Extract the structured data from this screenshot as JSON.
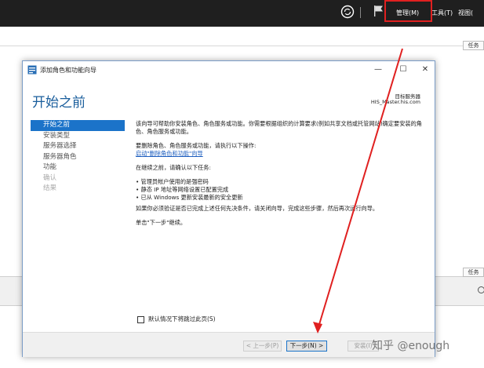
{
  "server_manager": {
    "menu": {
      "manage": "管理(M)",
      "tools": "工具(T)",
      "view": "视图("
    },
    "tasks_label": "任务",
    "highlight_color": "#e02020"
  },
  "wizard": {
    "window_title": "添加角色和功能向导",
    "page_title": "开始之前",
    "target_server_label": "目标服务器",
    "target_server_name": "HIS_Master.his.com",
    "nav": [
      {
        "label": "开始之前",
        "state": "active"
      },
      {
        "label": "安装类型",
        "state": "normal"
      },
      {
        "label": "服务器选择",
        "state": "normal"
      },
      {
        "label": "服务器角色",
        "state": "normal"
      },
      {
        "label": "功能",
        "state": "normal"
      },
      {
        "label": "确认",
        "state": "disabled"
      },
      {
        "label": "结果",
        "state": "disabled"
      }
    ],
    "content": {
      "intro": "该向导可帮助你安装角色、角色服务或功能。你需要根据组织的计算要求(例如共享文档或托管网站)确定要安装的角色、角色服务或功能。",
      "remove_prompt": "要删除角色、角色服务或功能，请执行以下操作:",
      "remove_link": "启动\"删除角色和功能\"向导",
      "verify_prompt": "在继续之前，请确认以下任务:",
      "tasks": [
        "• 管理员帐户使用的是强密码",
        "• 静态 IP 地址等网络设置已配置完成",
        "• 已从 Windows 更新安装最新的安全更新"
      ],
      "prerequisite_note": "如果你必须验证是否已完成上述任何先决条件，请关闭向导，完成这些步骤，然后再次运行向导。",
      "continue_hint": "单击\"下一步\"继续。"
    },
    "skip_checkbox_label": "默认情况下将跳过此页(S)",
    "buttons": {
      "prev": "< 上一步(P)",
      "next": "下一步(N) >",
      "install": "安装(I)"
    }
  },
  "watermark": "知乎 @enough"
}
